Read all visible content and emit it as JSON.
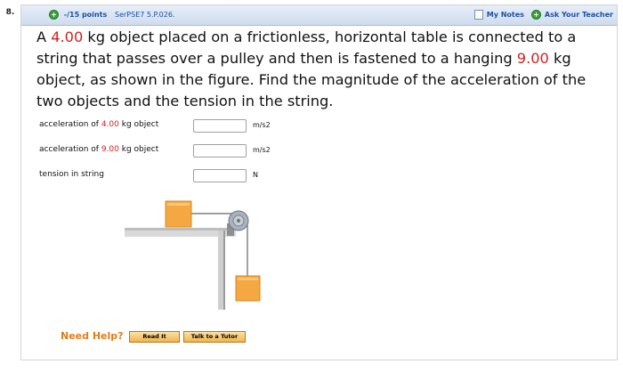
{
  "question_number": "8.",
  "header": {
    "points": "-/15 points",
    "code": "SerPSE7 5.P.026.",
    "my_notes": "My Notes",
    "ask_teacher": "Ask Your Teacher"
  },
  "question": {
    "p1": "A ",
    "mass1": "4.00",
    "p2": " kg object placed on a frictionless, horizontal table is connected to a string that passes over a pulley and then is fastened to a hanging ",
    "mass2": "9.00",
    "p3": " kg object, as shown in the figure. Find the magnitude of the acceleration of the two objects and the tension in the string."
  },
  "answers": [
    {
      "pre": "acceleration of ",
      "val": "4.00",
      "post": " kg object",
      "unit": "m/s2"
    },
    {
      "pre": "acceleration of ",
      "val": "9.00",
      "post": " kg object",
      "unit": "m/s2"
    },
    {
      "pre": "tension in string",
      "val": "",
      "post": "",
      "unit": "N"
    }
  ],
  "help": {
    "label": "Need Help?",
    "read_it": "Read It",
    "talk_tutor": "Talk to a Tutor"
  },
  "colors": {
    "header_bg": "#d7e2f1",
    "link_blue": "#1d4fa6",
    "value_red": "#d42020",
    "help_orange": "#e07d1a",
    "block_orange": "#f5a742"
  },
  "icons": {
    "plus": "plus-circle-icon",
    "notes": "notes-checkbox-icon"
  }
}
